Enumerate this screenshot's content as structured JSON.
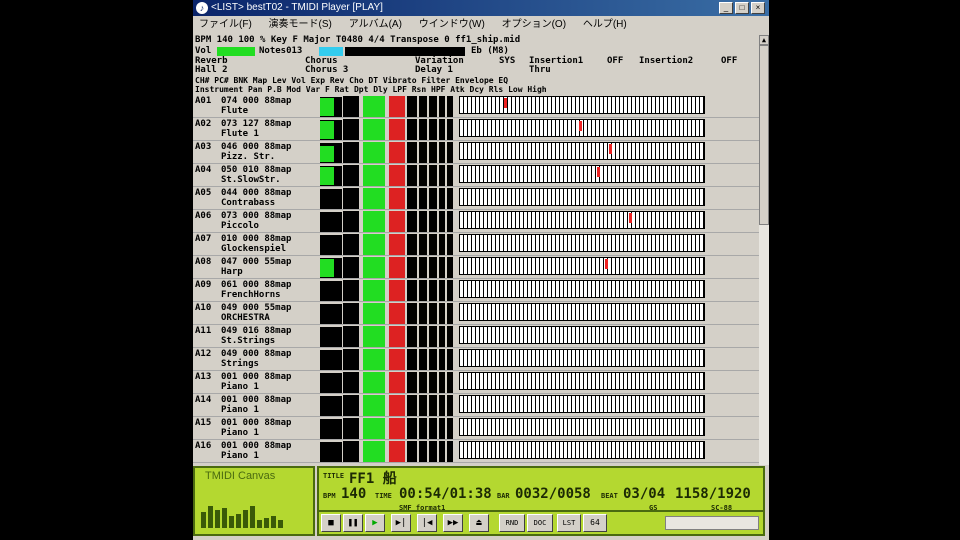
{
  "window": {
    "title": "<LIST> bestT02 - TMIDI Player [PLAY]",
    "buttons": [
      "_",
      "□",
      "×"
    ]
  },
  "menu": [
    "ファイル(F)",
    "演奏モード(S)",
    "アルバム(A)",
    "ウインドウ(W)",
    "オプション(O)",
    "ヘルプ(H)"
  ],
  "info": {
    "line1": "BPM 140 100 % Key F Major T0480  4/4  Transpose 0  ff1_ship.mid",
    "vol_label": "Vol",
    "notes_label": "Notes013",
    "key_label": "Eb (M8)",
    "reverb_label": "Reverb",
    "reverb_value": "Hall 2",
    "chorus_label": "Chorus",
    "chorus_value": "Chorus 3",
    "variation_label": "Variation",
    "variation_value": "Delay 1",
    "sys_label": "SYS",
    "sys_value": "Thru",
    "insertion1_label": "Insertion1",
    "insertion1_value": "OFF",
    "insertion2_label": "Insertion2",
    "insertion2_value": "OFF",
    "header1": "CH# PC# BNK Map    Lev Vol Exp Rev Cho DT   Vibrato    Filter   Envelope  EQ",
    "header2": "Instrument         Pan P.B Mod Var F      Rat Dpt Dly LPF Rsn HPF Atk Dcy Rls Low  High"
  },
  "channels": [
    {
      "ch": "A01",
      "line1": "074 000 88map",
      "name": "Flute",
      "level": 0.9,
      "note": 45
    },
    {
      "ch": "A02",
      "line1": "073 127 88map",
      "name": "Flute 1",
      "level": 0.9,
      "note": 120
    },
    {
      "ch": "A03",
      "line1": "046 000 88map",
      "name": "Pizz. Str.",
      "level": 0.8,
      "note": 150
    },
    {
      "ch": "A04",
      "line1": "050 010 88map",
      "name": "St.SlowStr.",
      "level": 0.9,
      "note": 138
    },
    {
      "ch": "A05",
      "line1": "044 000 88map",
      "name": "Contrabass",
      "level": 0.0,
      "note": -1
    },
    {
      "ch": "A06",
      "line1": "073 000 88map",
      "name": "Piccolo",
      "level": 0.0,
      "note": 170
    },
    {
      "ch": "A07",
      "line1": "010 000 88map",
      "name": "Glockenspiel",
      "level": 0.0,
      "note": -1
    },
    {
      "ch": "A08",
      "line1": "047 000 55map",
      "name": "Harp",
      "level": 0.9,
      "note": 146
    },
    {
      "ch": "A09",
      "line1": "061 000 88map",
      "name": "FrenchHorns",
      "level": 0.0,
      "note": -1
    },
    {
      "ch": "A10",
      "line1": "049 000 55map",
      "name": "ORCHESTRA",
      "level": 0.0,
      "note": -1
    },
    {
      "ch": "A11",
      "line1": "049 016 88map",
      "name": "St.Strings",
      "level": 0.0,
      "note": -1
    },
    {
      "ch": "A12",
      "line1": "049 000 88map",
      "name": "Strings",
      "level": 0.0,
      "note": -1
    },
    {
      "ch": "A13",
      "line1": "001 000 88map",
      "name": "Piano 1",
      "level": 0.0,
      "note": -1
    },
    {
      "ch": "A14",
      "line1": "001 000 88map",
      "name": "Piano 1",
      "level": 0.0,
      "note": -1
    },
    {
      "ch": "A15",
      "line1": "001 000 88map",
      "name": "Piano 1",
      "level": 0.0,
      "note": -1
    },
    {
      "ch": "A16",
      "line1": "001 000 88map",
      "name": "Piano 1",
      "level": 0.0,
      "note": -1
    }
  ],
  "canvas": {
    "label": "TMIDI Canvas",
    "bars": [
      0.4,
      0.55,
      0.45,
      0.5,
      0.3,
      0.35,
      0.45,
      0.55,
      0.2,
      0.25,
      0.3,
      0.2
    ]
  },
  "lcd": {
    "title_label": "TITLE",
    "title": "FF1 船",
    "bpm_label": "BPM",
    "bpm": "140",
    "time_label": "TIME",
    "time": "00:54/01:38",
    "bar_label": "BAR",
    "bar": "0032/0058",
    "beat_label": "BEAT",
    "beat": "03/04",
    "tick": "1158/1920",
    "smf": "SMF format1",
    "mode": "GS",
    "sc": "SC-88"
  },
  "controls": [
    "■",
    "❚❚",
    "▶",
    "▶|",
    "|◀",
    "▶▶",
    "⏏",
    "RND",
    "DOC",
    "LST",
    "64"
  ]
}
